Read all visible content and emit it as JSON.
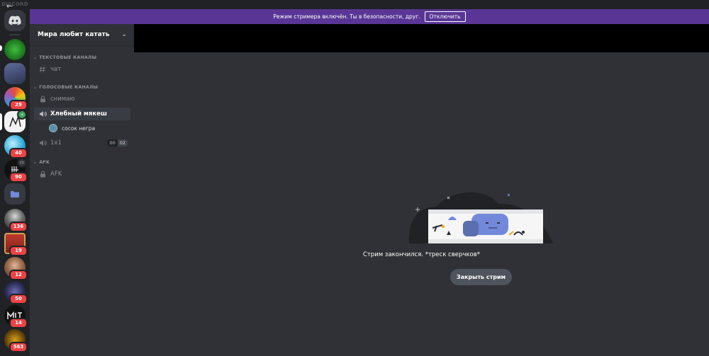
{
  "app": {
    "brand": "DISCORD"
  },
  "banner": {
    "text": "Режим стримера включён. Ты в безопасности, друг.",
    "button": "Отключить",
    "color": "#593695"
  },
  "servers": [
    {
      "badge": ""
    },
    {
      "badge": ""
    },
    {
      "badge": "29"
    },
    {
      "badge": ""
    },
    {
      "badge": "40"
    },
    {
      "badge": "90"
    },
    {
      "badge": ""
    },
    {
      "badge": "136"
    },
    {
      "badge": "19"
    },
    {
      "badge": "12"
    },
    {
      "badge": "50"
    },
    {
      "badge": "14"
    },
    {
      "badge": "563"
    }
  ],
  "sidebar": {
    "guild_name": "Мира любит катать",
    "categories": {
      "text": "ТЕКСТОВЫЕ КАНАЛЫ",
      "voice": "ГОЛОСОВЫЕ КАНАЛЫ",
      "afk": "AFK"
    },
    "text_channels": [
      {
        "name": "чат"
      }
    ],
    "voice_channels": [
      {
        "name": "снимаю"
      },
      {
        "name": "Хлебный мякеш"
      },
      {
        "name": "1х1",
        "count_a": "00",
        "count_b": "02"
      }
    ],
    "voice_user": "сосок негра",
    "afk_channel": "AFK"
  },
  "main": {
    "message": "Стрим закончился. *треск сверчков*",
    "close_button": "Закрыть стрим"
  }
}
